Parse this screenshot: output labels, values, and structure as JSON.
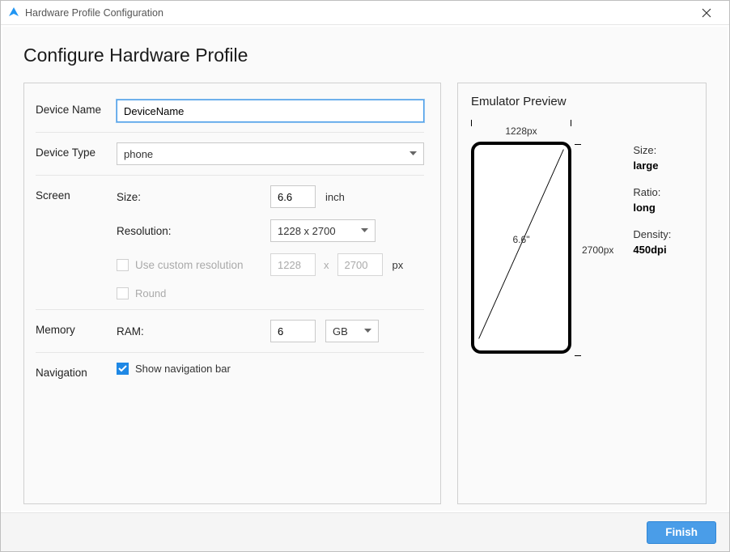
{
  "window": {
    "title": "Hardware Profile Configuration"
  },
  "page_title": "Configure Hardware Profile",
  "form": {
    "device_name": {
      "label": "Device Name",
      "value": "DeviceName"
    },
    "device_type": {
      "label": "Device Type",
      "value": "phone"
    },
    "screen": {
      "label": "Screen",
      "size_label": "Size:",
      "size_value": "6.6",
      "size_unit": "inch",
      "resolution_label": "Resolution:",
      "resolution_value": "1228 x 2700",
      "custom_label": "Use custom resolution",
      "custom_checked": false,
      "custom_w": "1228",
      "custom_h": "2700",
      "custom_sep": "x",
      "custom_unit": "px",
      "round_label": "Round",
      "round_checked": false
    },
    "memory": {
      "label": "Memory",
      "ram_label": "RAM:",
      "ram_value": "6",
      "ram_unit": "GB"
    },
    "navigation": {
      "label": "Navigation",
      "show_nav_label": "Show navigation bar",
      "show_nav_checked": true
    }
  },
  "preview": {
    "title": "Emulator Preview",
    "width_px": "1228px",
    "height_px": "2700px",
    "diagonal": "6.6\"",
    "specs": {
      "size_label": "Size:",
      "size_value": "large",
      "ratio_label": "Ratio:",
      "ratio_value": "long",
      "density_label": "Density:",
      "density_value": "450dpi"
    }
  },
  "footer": {
    "finish": "Finish"
  }
}
